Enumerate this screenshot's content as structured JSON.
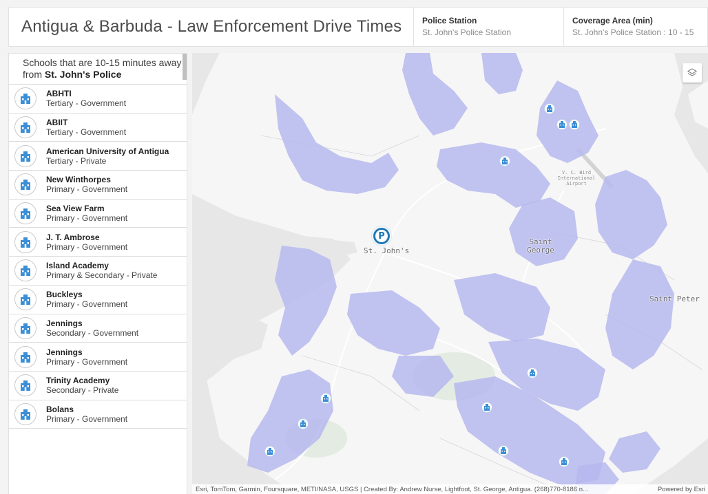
{
  "app": {
    "title": "Antigua & Barbuda - Law Enforcement Drive Times"
  },
  "header": {
    "station_label": "Police Station",
    "station_value": "St. John's Police Station",
    "coverage_label": "Coverage Area (min)",
    "coverage_value": "St. John's Police Station : 10 - 15"
  },
  "panel": {
    "heading_prefix": "Schools that are 10-15 minutes away from ",
    "heading_bold": "St. John's Police",
    "schools": [
      {
        "name": "ABHTI",
        "type": "Tertiary - Government"
      },
      {
        "name": "ABIIT",
        "type": "Tertiary - Government"
      },
      {
        "name": "American University of Antigua",
        "type": "Tertiary - Private"
      },
      {
        "name": "New Winthorpes",
        "type": "Primary - Government"
      },
      {
        "name": "Sea View Farm",
        "type": "Primary - Government"
      },
      {
        "name": "J. T. Ambrose",
        "type": "Primary - Government"
      },
      {
        "name": "Island Academy",
        "type": "Primary & Secondary - Private"
      },
      {
        "name": "Buckleys",
        "type": "Primary - Government"
      },
      {
        "name": "Jennings",
        "type": "Secondary - Government"
      },
      {
        "name": "Jennings",
        "type": "Primary - Government"
      },
      {
        "name": "Trinity Academy",
        "type": "Secondary - Private"
      },
      {
        "name": "Bolans",
        "type": "Primary - Government"
      }
    ]
  },
  "map": {
    "labels": {
      "st_johns": "St. John's",
      "saint_george": "Saint George",
      "saint_peter": "Saint Peter",
      "airport": "V. C. Bird International Airport"
    },
    "police_glyph": "P",
    "attribution": "Esri, TomTom, Garmin, Foursquare, METI/NASA, USGS | Created By: Andrew Nurse, Lightfoot, St. George, Antigua. (268)770-8186 n...",
    "powered_by": "Powered by Esri"
  },
  "colors": {
    "coverage_fill": "#b6b8ee",
    "water": "#e7e7e7",
    "land": "#f7f7f7",
    "accent": "#1c78b8",
    "school_icon": "#3b8fd6"
  }
}
